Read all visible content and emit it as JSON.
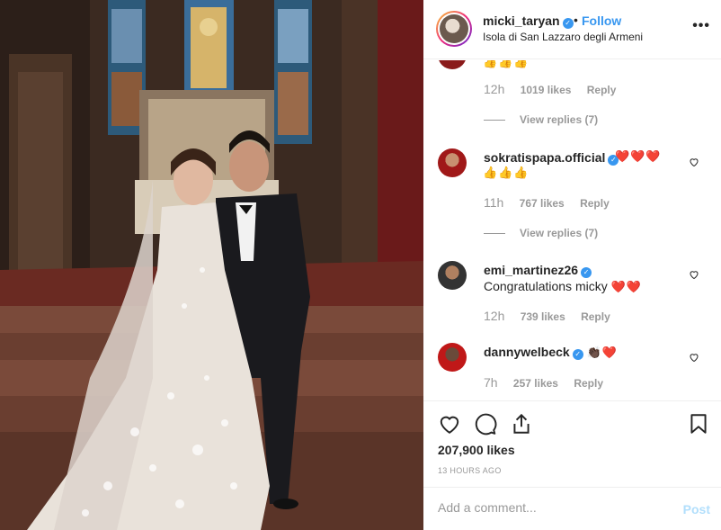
{
  "post": {
    "username": "micki_taryan",
    "follow_label": "Follow",
    "separator": "•",
    "location": "Isola di San Lazzaro degli Armeni",
    "more_label": "•••",
    "likes": "207,900 likes",
    "time_ago": "13 HOURS AGO"
  },
  "comments": [
    {
      "emoji_text": "👍👍👍",
      "time": "12h",
      "likes": "1019 likes",
      "reply_label": "Reply",
      "view_replies": "View replies (7)"
    },
    {
      "username": "sokratispapa.official",
      "verified": true,
      "text_line1": "❤️❤️❤️",
      "text_line2": "👍👍👍",
      "time": "11h",
      "likes": "767 likes",
      "reply_label": "Reply",
      "view_replies": "View replies (7)"
    },
    {
      "username": "emi_martinez26",
      "verified": true,
      "text": "Congratulations micky",
      "emoji": "❤️❤️",
      "time": "12h",
      "likes": "739 likes",
      "reply_label": "Reply"
    },
    {
      "username": "dannywelbeck",
      "verified": true,
      "emoji": "👏🏿❤️",
      "time": "7h",
      "likes": "257 likes",
      "reply_label": "Reply"
    }
  ],
  "add_comment": {
    "placeholder": "Add a comment...",
    "post_label": "Post"
  },
  "colors": {
    "accent": "#3897f0",
    "muted": "#999999",
    "post_disabled": "#b2dffc"
  }
}
